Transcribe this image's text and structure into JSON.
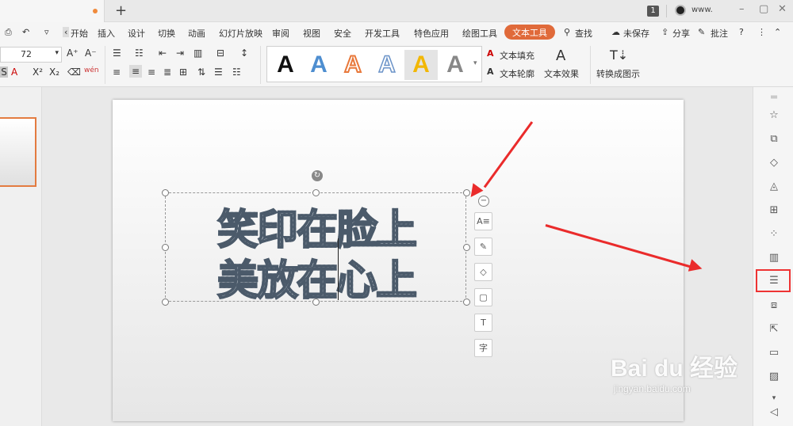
{
  "tabbar": {
    "page_number": "1",
    "user": "www.",
    "win_min": "–",
    "win_max": "▢",
    "win_close": "✕",
    "new_tab": "+"
  },
  "menu": [
    "开始",
    "插入",
    "设计",
    "切换",
    "动画",
    "幻灯片放映",
    "审阅",
    "视图",
    "安全",
    "开发工具",
    "特色应用",
    "绘图工具",
    "文本工具"
  ],
  "menu_right": {
    "search": "查找",
    "unsaved": "未保存",
    "share": "分享",
    "comment": "批注"
  },
  "ribbon": {
    "font_size": "72",
    "text_fill": "文本填充",
    "text_outline": "文本轮廓",
    "text_effect": "文本效果",
    "convert": "转换成图示",
    "style_glyph": "A"
  },
  "slide": {
    "line1": "笑印在脸上",
    "line2": "美放在心上"
  },
  "float_tools": {
    "collapse": "−",
    "t1": "A≡",
    "t2": "✎",
    "t3": "◇",
    "t4": "▢",
    "t5": "T",
    "t6": "字"
  },
  "colors": {
    "accent": "#e06a3a",
    "arrow": "#ea2b2b",
    "highlight": "#e33333"
  },
  "watermark": {
    "brand": "Bai du 经验",
    "url": "jingyan.baidu.com"
  }
}
